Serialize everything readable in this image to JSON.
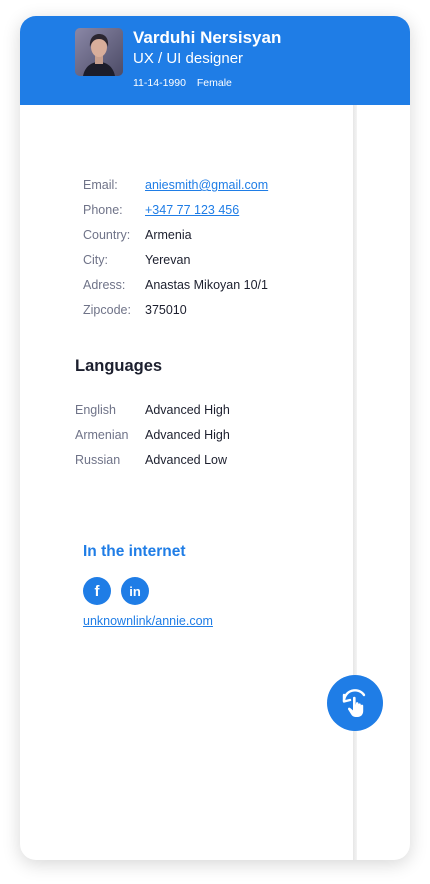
{
  "profile": {
    "name": "Varduhi Nersisyan",
    "role": "UX / UI designer",
    "birthdate": "11-14-1990",
    "gender": "Female"
  },
  "contact": [
    {
      "label": "Email:",
      "value": "aniesmith@gmail.com",
      "link": true
    },
    {
      "label": "Phone:",
      "value": "+347 77 123 456",
      "link": true
    },
    {
      "label": "Country:",
      "value": "Armenia",
      "link": false
    },
    {
      "label": "City:",
      "value": "Yerevan",
      "link": false
    },
    {
      "label": "Adress:",
      "value": "Anastas Mikoyan 10/1",
      "link": false
    },
    {
      "label": "Zipcode:",
      "value": "375010",
      "link": false
    }
  ],
  "languages": {
    "title": "Languages",
    "items": [
      {
        "name": "English",
        "level": "Advanced High"
      },
      {
        "name": "Armenian",
        "level": "Advanced High"
      },
      {
        "name": "Russian",
        "level": "Advanced Low"
      }
    ]
  },
  "internet": {
    "title": "In the internet",
    "socials": [
      {
        "glyph": "f",
        "icon": "facebook-icon"
      },
      {
        "glyph": "in",
        "icon": "linkedin-icon"
      }
    ],
    "link": "unknownlink/annie.com"
  },
  "fab": {
    "icon": "tap-rotate-icon"
  },
  "colors": {
    "accent": "#1f7de6",
    "text": "#1c1f2e",
    "muted": "#6f7388"
  }
}
